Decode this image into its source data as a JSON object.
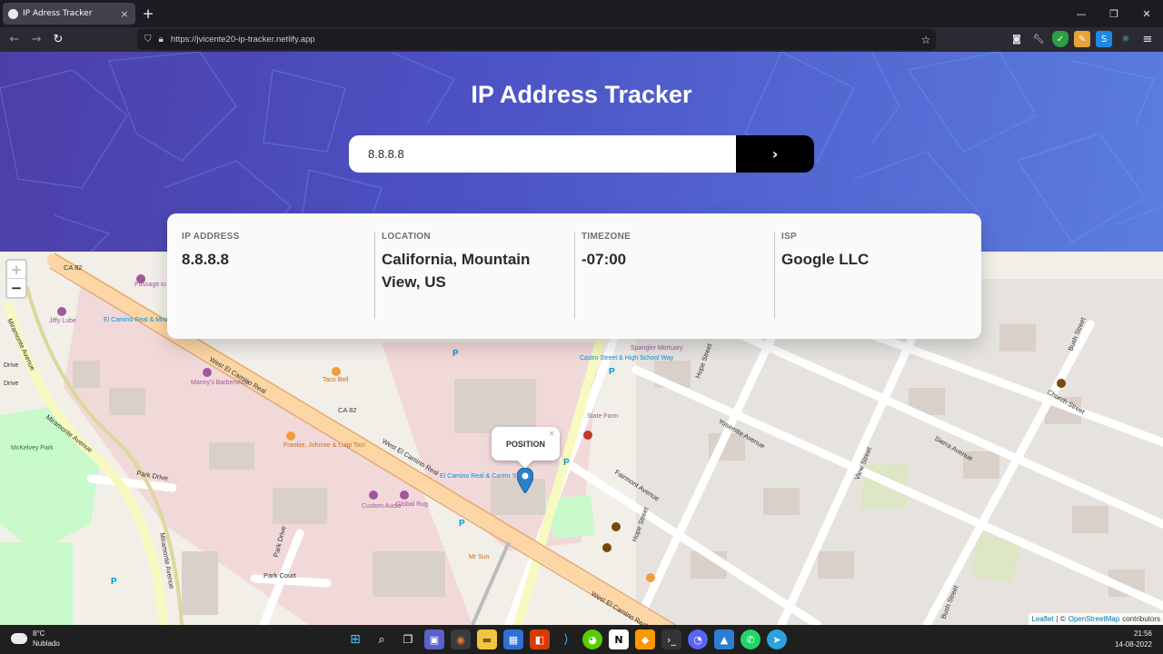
{
  "browser": {
    "tab_title": "IP Adress Tracker",
    "tab_close": "×",
    "new_tab": "+",
    "url": "https://jvicente20-ip-tracker.netlify.app",
    "window_controls": {
      "minimize": "—",
      "restore": "❐",
      "close": "✕"
    },
    "nav": {
      "back": "←",
      "forward": "→",
      "reload": "↻"
    },
    "extension_icons": [
      "pocket-icon",
      "wrench-icon",
      "shield-icon",
      "pencil-icon",
      "s-extension-icon",
      "react-icon",
      "menu-icon"
    ]
  },
  "app": {
    "title": "IP Address Tracker",
    "search": {
      "value": "8.8.8.8",
      "placeholder": "",
      "button_label": "›"
    },
    "info": {
      "ip_label": "IP ADDRESS",
      "ip_value": "8.8.8.8",
      "location_label": "LOCATION",
      "location_value": "California, Mountain View, US",
      "timezone_label": "TIMEZONE",
      "timezone_value": "-07:00",
      "isp_label": "ISP",
      "isp_value": "Google LLC"
    },
    "hero_colors": {
      "start": "#4d3fa8",
      "end": "#5b7de0"
    }
  },
  "map": {
    "zoom_in": "+",
    "zoom_out": "−",
    "popup_text": "POSITION",
    "popup_close": "×",
    "attribution": {
      "leaflet": "Leaflet",
      "separator": "| ©",
      "osm": "OpenStreetMap",
      "contributors": "contributors"
    },
    "street_labels": [
      "West El Camino Real",
      "West El Camino Real",
      "West El Camino Real",
      "CA 82",
      "CA 82",
      "Miramonte Avenue",
      "Miramonte Avenue",
      "Miramonte Avenue",
      "Park Drive",
      "Park Drive",
      "Park Court",
      "Fairmont Avenue",
      "Yosemite Avenue",
      "Sierra Avenue",
      "View Street",
      "Hope Street",
      "Hope Street",
      "Church Street",
      "Bush Street",
      "Bush Street",
      "Taco Bell",
      "Custom Audio",
      "Global Rug",
      "McKelvey Park",
      "Jiffy Lube",
      "Manny's Barbershop",
      "Mr Sun",
      "State Farm",
      "Spangler Mortuary",
      "Passage to India Bakery",
      "El Camino Real & Miramonte Avenue",
      "Castro Street & High School Way",
      "El Camino Real & Castro Street",
      "Frankie, Johnnie & Luigi Too!",
      "Drive",
      "Drive"
    ]
  },
  "taskbar": {
    "weather_temp": "8°C",
    "weather_desc": "Nublado",
    "time": "21:56",
    "date": "14-08-2022",
    "apps": [
      "windows-start-icon",
      "search-icon",
      "task-view-icon",
      "teams-icon",
      "firefox-icon",
      "explorer-icon",
      "store-icon",
      "office-icon",
      "vscode-icon",
      "duolingo-icon",
      "notion-icon",
      "sublime-icon",
      "terminal-icon",
      "discord-icon",
      "photos-icon",
      "whatsapp-icon",
      "telegram-icon"
    ]
  }
}
